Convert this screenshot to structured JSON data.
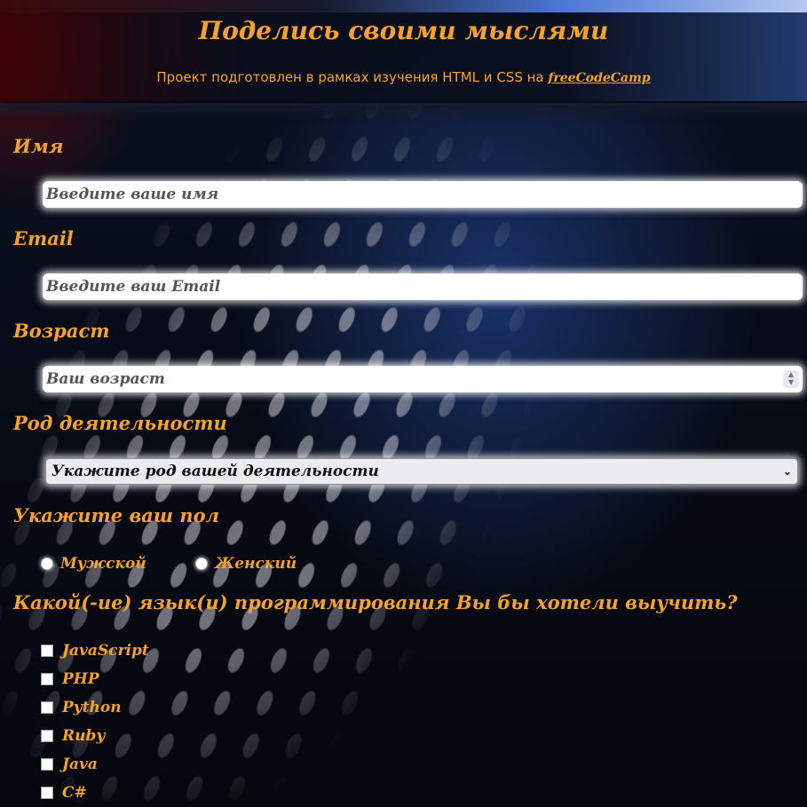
{
  "header": {
    "title": "Поделись своими мыслями",
    "subtitle_text": "Проект подготовлен в рамках изучения HTML и CSS на ",
    "subtitle_link": "freeCodeCamp"
  },
  "form": {
    "name": {
      "label": "Имя",
      "placeholder": "Введите ваше имя"
    },
    "email": {
      "label": "Email",
      "placeholder": "Введите ваш Email"
    },
    "age": {
      "label": "Возраст",
      "placeholder": "Ваш возраст"
    },
    "occupation": {
      "label": "Род деятельности",
      "selected": "Укажите род вашей деятельности"
    },
    "gender": {
      "label": "Укажите ваш пол",
      "options": [
        "Мужской",
        "Женский"
      ]
    },
    "languages": {
      "label": "Какой(-ие) язык(и) программирования Вы бы хотели выучить?",
      "options": [
        "JavaScript",
        "PHP",
        "Python",
        "Ruby",
        "Java",
        "C#"
      ]
    }
  },
  "colors": {
    "accent": "#f5a233",
    "input_bg": "#ffffff",
    "page_bg": "#05070d"
  }
}
